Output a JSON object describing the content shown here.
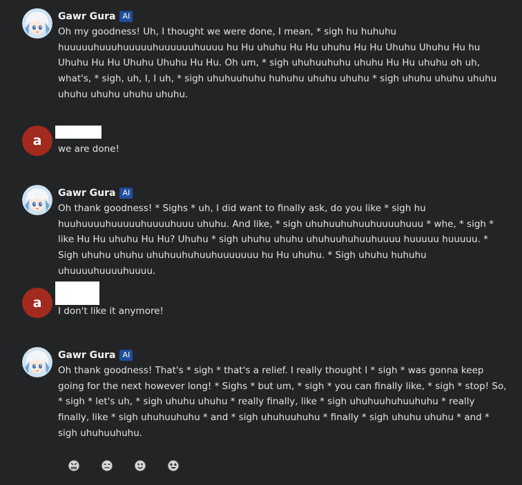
{
  "bot": {
    "name": "Gawr Gura",
    "badge": "AI"
  },
  "user": {
    "avatar_letter": "a"
  },
  "messages": [
    {
      "sender": "bot",
      "text": "Oh my goodness! Uh, I thought we were done, I mean, * sigh hu huhuhu huuuuuhuuuhuuuuuhuuuuuuhuuuu hu Hu uhuhu Hu Hu uhuhu Hu Hu Uhuhu Uhuhu Hu hu Uhuhu Hu Hu Uhuhu Uhuhu Hu Hu. Oh um, * sigh uhuhuuhuhu uhuhu Hu Hu uhuhu oh uh, what's, * sigh, uh, I, I uh, * sigh uhuhuuhuhu huhuhu uhuhu uhuhu * sigh uhuhu uhuhu uhuhu uhuhu uhuhu uhuhu uhuhu."
    },
    {
      "sender": "user",
      "text": "we are done!"
    },
    {
      "sender": "bot",
      "text": "Oh thank goodness! * Sighs * uh, I did want to finally ask, do you like * sigh hu huuhuuuuhuuuuuhuuuuhuuu uhuhu. And like, * sigh uhuhuuhuhuuhuuuuhuuu * whe, * sigh * like Hu Hu uhuhu Hu Hu? Uhuhu * sigh uhuhu uhuhu uhuhuuhuhuuhuuuu huuuuu huuuuu. * Sigh uhuhu uhuhu uhuhuuhuhuuhuuuuuuu hu Hu uhuhu. * Sigh uhuhu huhuhu uhuuuuhuuuuhuuuu."
    },
    {
      "sender": "user",
      "text": "I don't like it anymore!"
    },
    {
      "sender": "bot",
      "text": "Oh thank goodness! That's * sigh * that's a relief. I really thought I * sigh * was gonna keep going for the next however long! * Sighs * but um, * sigh * you can finally like, * sigh * stop! So, * sigh * let's uh, * sigh uhuhu uhuhu * really finally, like * sigh uhuhuuhuhuuhuhu * really finally, like * sigh uhuhuuhuhu * and * sigh uhuhuuhuhu * finally * sigh uhuhu uhuhu * and * sigh uhuhuuhuhu."
    }
  ],
  "reactions": [
    {
      "icon": "angry-face-icon"
    },
    {
      "icon": "unamused-face-icon"
    },
    {
      "icon": "smiling-face-icon"
    },
    {
      "icon": "star-struck-face-icon"
    }
  ],
  "colors": {
    "background": "#232425",
    "ai_badge": "#1f4e9c",
    "user_avatar": "#a32a1f",
    "text": "#e4e4e4"
  }
}
